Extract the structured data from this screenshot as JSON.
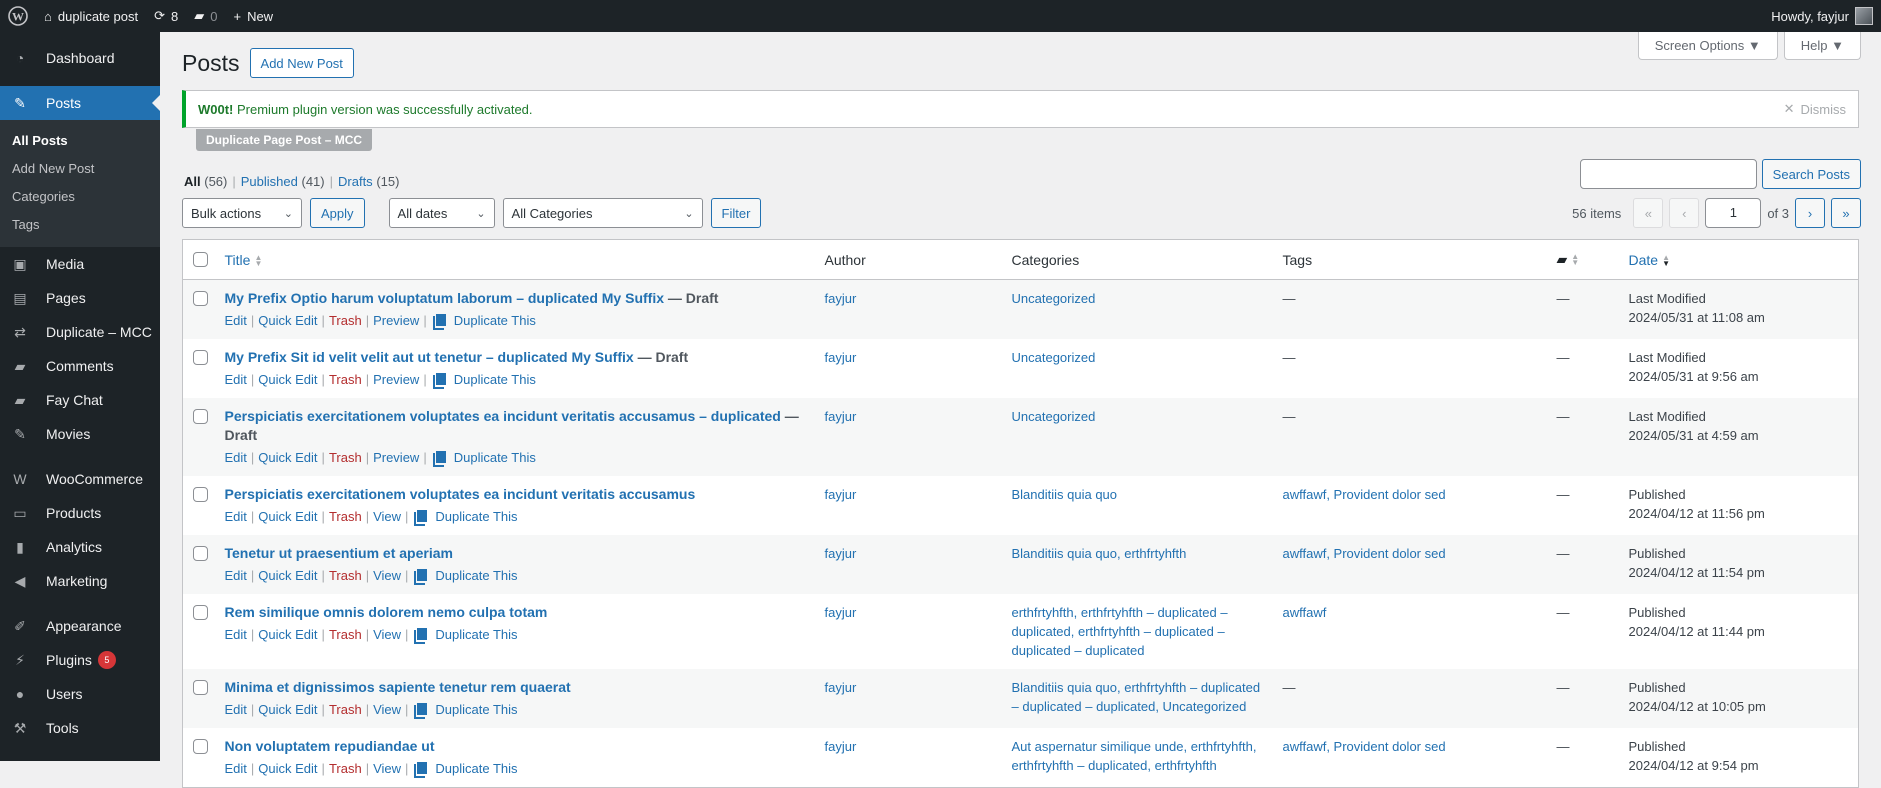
{
  "adminbar": {
    "site_name": "duplicate post",
    "updates_count": "8",
    "comments_count": "0",
    "new_label": "New",
    "howdy": "Howdy, fayjur"
  },
  "sidebar": {
    "items": [
      {
        "label": "Dashboard",
        "icon": "dashboard-icon",
        "glyph": "◔"
      },
      {
        "label": "Posts",
        "icon": "pin-icon",
        "glyph": "✎",
        "current": true
      },
      {
        "label": "Media",
        "icon": "media-icon",
        "glyph": "▣"
      },
      {
        "label": "Pages",
        "icon": "pages-icon",
        "glyph": "▤"
      },
      {
        "label": "Duplicate – MCC",
        "icon": "duplicate-icon",
        "glyph": "⇄"
      },
      {
        "label": "Comments",
        "icon": "comment-icon",
        "glyph": "▰"
      },
      {
        "label": "Fay Chat",
        "icon": "chat-icon",
        "glyph": "▰"
      },
      {
        "label": "Movies",
        "icon": "pin-icon",
        "glyph": "✎"
      },
      {
        "label": "WooCommerce",
        "icon": "woo-icon",
        "glyph": "W"
      },
      {
        "label": "Products",
        "icon": "archive-icon",
        "glyph": "▭"
      },
      {
        "label": "Analytics",
        "icon": "bar-chart-icon",
        "glyph": "▮"
      },
      {
        "label": "Marketing",
        "icon": "megaphone-icon",
        "glyph": "◀"
      },
      {
        "label": "Appearance",
        "icon": "brush-icon",
        "glyph": "✐"
      },
      {
        "label": "Plugins",
        "icon": "plug-icon",
        "glyph": "⚡",
        "badge": "5"
      },
      {
        "label": "Users",
        "icon": "user-icon",
        "glyph": "●"
      },
      {
        "label": "Tools",
        "icon": "wrench-icon",
        "glyph": "⚒"
      }
    ],
    "submenu": [
      "All Posts",
      "Add New Post",
      "Categories",
      "Tags"
    ]
  },
  "screen_meta": {
    "screen_options": "Screen Options ▼",
    "help": "Help ▼"
  },
  "page": {
    "title": "Posts",
    "add_new": "Add New Post",
    "notice_strong": "W00t!",
    "notice_text": " Premium plugin version was successfully activated.",
    "dismiss": "Dismiss",
    "plugin_tag": "Duplicate Page Post – MCC"
  },
  "views": [
    {
      "label": "All",
      "count": "(56)"
    },
    {
      "label": "Published",
      "count": "(41)"
    },
    {
      "label": "Drafts",
      "count": "(15)"
    }
  ],
  "search": {
    "value": "",
    "button": "Search Posts"
  },
  "filters": {
    "bulk_actions": "Bulk actions",
    "apply": "Apply",
    "dates": "All dates",
    "categories": "All Categories",
    "filter": "Filter"
  },
  "pagination": {
    "items": "56 items",
    "first": "«",
    "prev": "‹",
    "current": "1",
    "of": "of 3",
    "next": "›",
    "last": "»"
  },
  "table": {
    "columns": {
      "title": "Title",
      "author": "Author",
      "categories": "Categories",
      "tags": "Tags",
      "date": "Date"
    },
    "rows": [
      {
        "title": "My Prefix Optio harum voluptatum laborum – duplicated My Suffix",
        "state": " — Draft",
        "author": "fayjur",
        "categories": "Uncategorized",
        "tags": "—",
        "comments": "—",
        "date_status": "Last Modified",
        "date": "2024/05/31 at 11:08 am",
        "view": "Preview"
      },
      {
        "title": "My Prefix Sit id velit velit aut ut tenetur – duplicated My Suffix",
        "state": " — Draft",
        "author": "fayjur",
        "categories": "Uncategorized",
        "tags": "—",
        "comments": "—",
        "date_status": "Last Modified",
        "date": "2024/05/31 at 9:56 am",
        "view": "Preview"
      },
      {
        "title": "Perspiciatis exercitationem voluptates ea incidunt veritatis accusamus – duplicated",
        "state": " — Draft",
        "author": "fayjur",
        "categories": "Uncategorized",
        "tags": "—",
        "comments": "—",
        "date_status": "Last Modified",
        "date": "2024/05/31 at 4:59 am",
        "view": "Preview"
      },
      {
        "title": "Perspiciatis exercitationem voluptates ea incidunt veritatis accusamus",
        "state": "",
        "author": "fayjur",
        "categories": "Blanditiis quia quo",
        "tags": "awffawf, Provident dolor sed",
        "comments": "—",
        "date_status": "Published",
        "date": "2024/04/12 at 11:56 pm",
        "view": "View"
      },
      {
        "title": "Tenetur ut praesentium et aperiam",
        "state": "",
        "author": "fayjur",
        "categories": "Blanditiis quia quo, erthfrtyhfth",
        "tags": "awffawf, Provident dolor sed",
        "comments": "—",
        "date_status": "Published",
        "date": "2024/04/12 at 11:54 pm",
        "view": "View"
      },
      {
        "title": "Rem similique omnis dolorem nemo culpa totam",
        "state": "",
        "author": "fayjur",
        "categories": "erthfrtyhfth, erthfrtyhfth – duplicated – duplicated, erthfrtyhfth – duplicated – duplicated – duplicated",
        "tags": "awffawf",
        "comments": "—",
        "date_status": "Published",
        "date": "2024/04/12 at 11:44 pm",
        "view": "View"
      },
      {
        "title": "Minima et dignissimos sapiente tenetur rem quaerat",
        "state": "",
        "author": "fayjur",
        "categories": "Blanditiis quia quo, erthfrtyhfth – duplicated – duplicated – duplicated, Uncategorized",
        "tags": "—",
        "comments": "—",
        "date_status": "Published",
        "date": "2024/04/12 at 10:05 pm",
        "view": "View"
      },
      {
        "title": "Non voluptatem repudiandae ut",
        "state": "",
        "author": "fayjur",
        "categories": "Aut aspernatur similique unde, erthfrtyhfth, erthfrtyhfth – duplicated, erthfrtyhfth",
        "tags": "awffawf, Provident dolor sed",
        "comments": "—",
        "date_status": "Published",
        "date": "2024/04/12 at 9:54 pm",
        "view": "View"
      }
    ],
    "actions": {
      "edit": "Edit",
      "quick_edit": "Quick Edit",
      "trash": "Trash",
      "duplicate": "Duplicate This"
    }
  },
  "colors": {
    "accent": "#2271b1",
    "sidebar_bg": "#1d2327",
    "notice_success": "#00a32a",
    "trash": "#b32d2e"
  }
}
